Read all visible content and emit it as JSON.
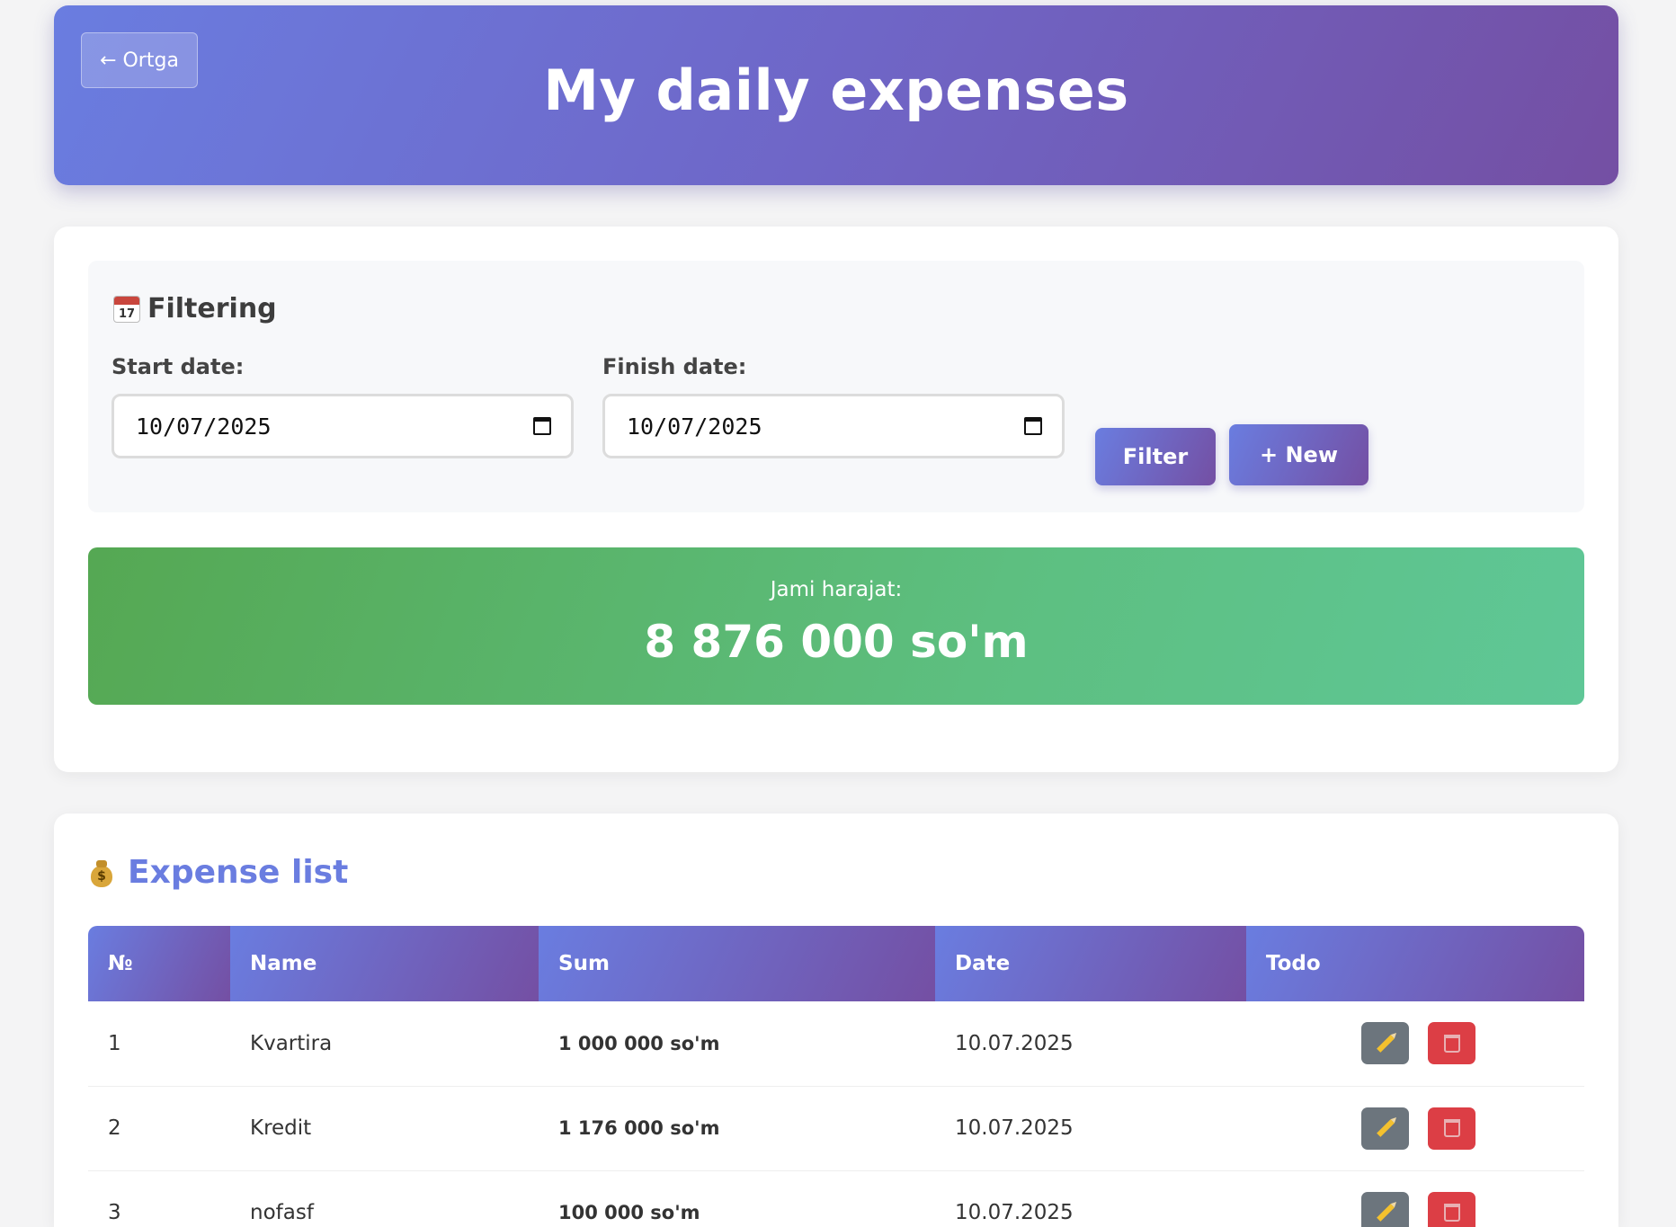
{
  "header": {
    "back_label": "← Ortga",
    "title": "My daily expenses"
  },
  "filter": {
    "heading": "Filtering",
    "heading_icon": "calendar-icon",
    "calendar_day": "17",
    "start_label": "Start date:",
    "start_value": "10/07/2025",
    "finish_label": "Finish date:",
    "finish_value": "10/07/2025",
    "filter_button": "Filter",
    "new_button": "+ New"
  },
  "total": {
    "label": "Jami harajat:",
    "value": "8 876 000 so'm"
  },
  "list": {
    "title": "Expense list",
    "title_icon": "money-bag-icon",
    "columns": [
      "№",
      "Name",
      "Sum",
      "Date",
      "Todo"
    ],
    "rows": [
      {
        "no": "1",
        "name": "Kvartira",
        "sum": "1 000 000 so'm",
        "date": "10.07.2025"
      },
      {
        "no": "2",
        "name": "Kredit",
        "sum": "1 176 000 so'm",
        "date": "10.07.2025"
      },
      {
        "no": "3",
        "name": "nofasf",
        "sum": "100 000 so'm",
        "date": "10.07.2025"
      }
    ]
  },
  "colors": {
    "accent": "#6a7de0",
    "accent_dark": "#744fa3",
    "total_green": "#5dbf80",
    "sum_red": "#d23b48",
    "edit_gray": "#6c757d",
    "delete_red": "#dc3e45"
  }
}
